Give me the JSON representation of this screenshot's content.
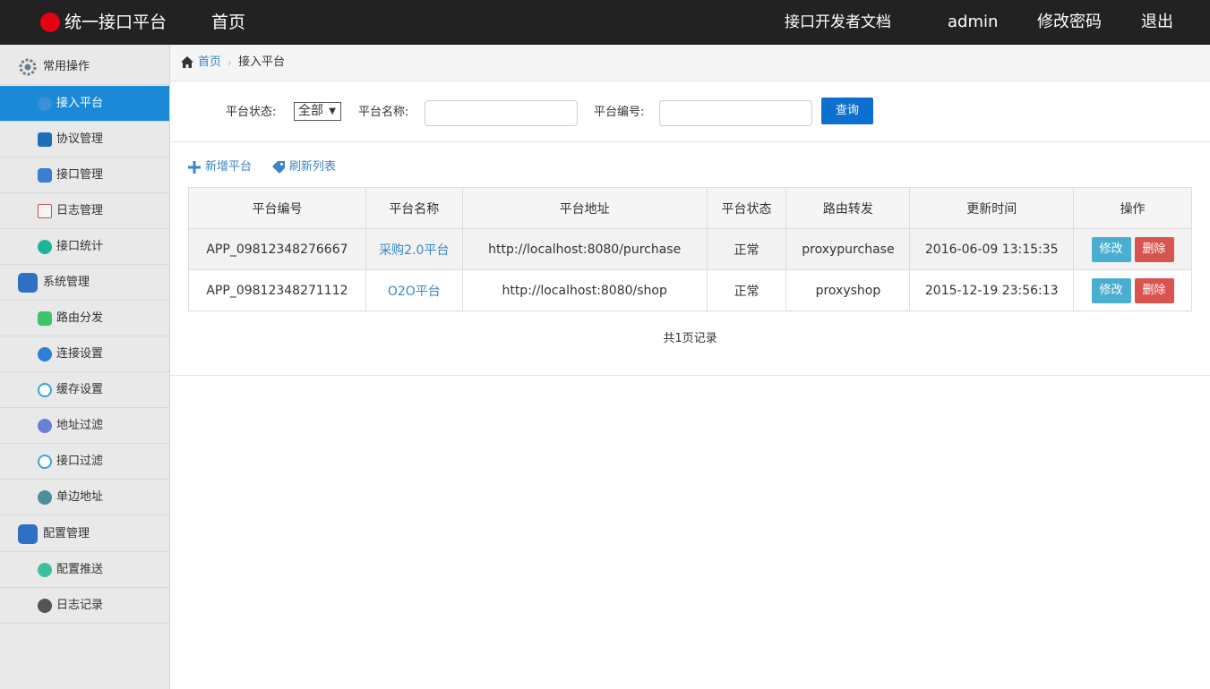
{
  "topbar": {
    "title": "统一接口平台",
    "home": "首页",
    "docs": "接口开发者文档",
    "user": "admin",
    "change_password": "修改密码",
    "logout": "退出"
  },
  "sidebar": {
    "groups": [
      {
        "label": "常用操作",
        "icon": "gear-icon",
        "items": [
          {
            "label": "接入平台",
            "icon": "accessibility-icon",
            "active": true
          },
          {
            "label": "协议管理",
            "icon": "protocol-icon"
          },
          {
            "label": "接口管理",
            "icon": "interface-icon"
          },
          {
            "label": "日志管理",
            "icon": "log-chart-icon"
          },
          {
            "label": "接口统计",
            "icon": "statistics-icon"
          }
        ]
      },
      {
        "label": "系统管理",
        "icon": "settings-icon",
        "items": [
          {
            "label": "路由分发",
            "icon": "route-icon"
          },
          {
            "label": "连接设置",
            "icon": "connection-icon"
          },
          {
            "label": "缓存设置",
            "icon": "cache-icon"
          },
          {
            "label": "地址过滤",
            "icon": "address-filter-icon"
          },
          {
            "label": "接口过滤",
            "icon": "interface-filter-icon"
          },
          {
            "label": "单边地址",
            "icon": "monitor-icon"
          }
        ]
      },
      {
        "label": "配置管理",
        "icon": "config-icon",
        "items": [
          {
            "label": "配置推送",
            "icon": "push-icon"
          },
          {
            "label": "日志记录",
            "icon": "record-icon"
          }
        ]
      }
    ]
  },
  "breadcrumb": {
    "home": "首页",
    "current": "接入平台"
  },
  "filters": {
    "status_label": "平台状态:",
    "status_value": "全部",
    "name_label": "平台名称:",
    "name_value": "",
    "code_label": "平台编号:",
    "code_value": "",
    "query_button": "查询"
  },
  "toolbar": {
    "add": "新增平台",
    "refresh": "刷新列表"
  },
  "table": {
    "columns": [
      "平台编号",
      "平台名称",
      "平台地址",
      "平台状态",
      "路由转发",
      "更新时间",
      "操作"
    ],
    "rows": [
      {
        "code": "APP_09812348276667",
        "name": "采购2.0平台",
        "url": "http://localhost:8080/purchase",
        "status": "正常",
        "route": "proxypurchase",
        "updated": "2016-06-09 13:15:35"
      },
      {
        "code": "APP_09812348271112",
        "name": "O2O平台",
        "url": "http://localhost:8080/shop",
        "status": "正常",
        "route": "proxyshop",
        "updated": "2015-12-19 23:56:13"
      }
    ],
    "edit_label": "修改",
    "delete_label": "删除"
  },
  "pager": {
    "text": "共1页记录"
  },
  "colors": {
    "topbar": "#222222",
    "active": "#1a8ad8",
    "primary": "#0d6fcf",
    "link": "#3a87c8",
    "edit": "#4aaed1",
    "delete": "#d9534f",
    "logo": "#e60012"
  }
}
